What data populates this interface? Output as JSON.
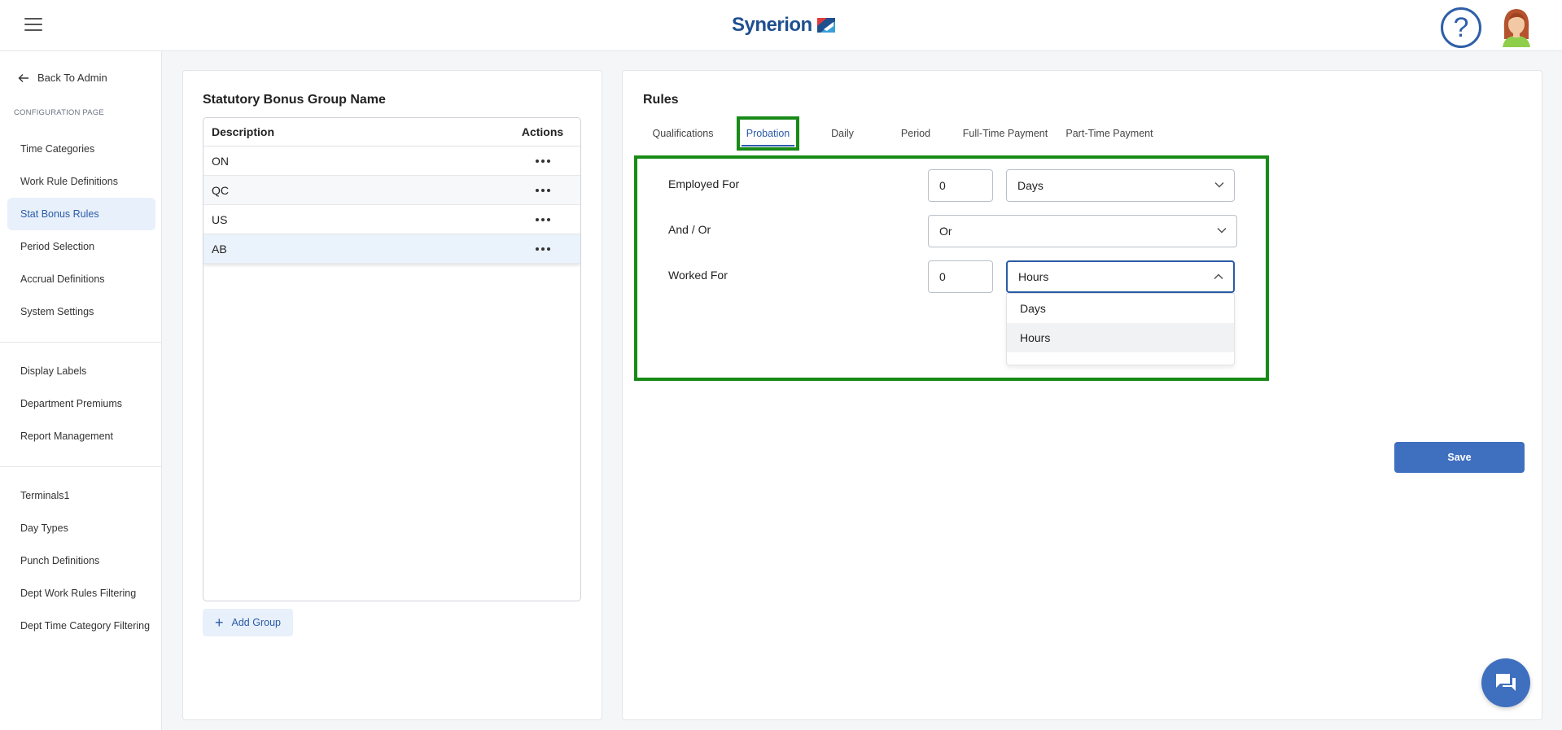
{
  "app": {
    "name": "Synerion"
  },
  "header": {
    "help_icon": "question-mark-icon",
    "avatar_alt": "user-avatar"
  },
  "sidebar": {
    "back_label": "Back To Admin",
    "section_title": "CONFIGURATION PAGE",
    "group1": [
      "Time Categories",
      "Work Rule Definitions",
      "Stat Bonus Rules",
      "Period Selection",
      "Accrual Definitions",
      "System Settings"
    ],
    "group2": [
      "Display Labels",
      "Department Premiums",
      "Report Management"
    ],
    "group3": [
      "Terminals1",
      "Day Types",
      "Punch Definitions",
      "Dept Work Rules Filtering",
      "Dept Time Category Filtering"
    ],
    "active_item": "Stat Bonus Rules"
  },
  "groups_panel": {
    "title": "Statutory Bonus Group Name",
    "columns": [
      "Description",
      "Actions"
    ],
    "rows": [
      "ON",
      "QC",
      "US",
      "AB"
    ],
    "selected_row": "AB",
    "add_label": "Add Group"
  },
  "rules_panel": {
    "title": "Rules",
    "tabs": [
      "Qualifications",
      "Probation",
      "Daily",
      "Period",
      "Full-Time Payment",
      "Part-Time Payment"
    ],
    "active_tab": "Probation",
    "employed_for": {
      "label": "Employed For",
      "value": "0",
      "unit": "Days"
    },
    "and_or": {
      "label": "And / Or",
      "value": "Or"
    },
    "worked_for": {
      "label": "Worked For",
      "value": "0",
      "unit": "Hours"
    },
    "unit_options": [
      "Days",
      "Hours"
    ],
    "highlighted_option": "Hours",
    "save_label": "Save"
  },
  "colors": {
    "accent": "#2a5ba6",
    "highlight_border": "#188a18",
    "save_button": "#3f6fbf"
  }
}
